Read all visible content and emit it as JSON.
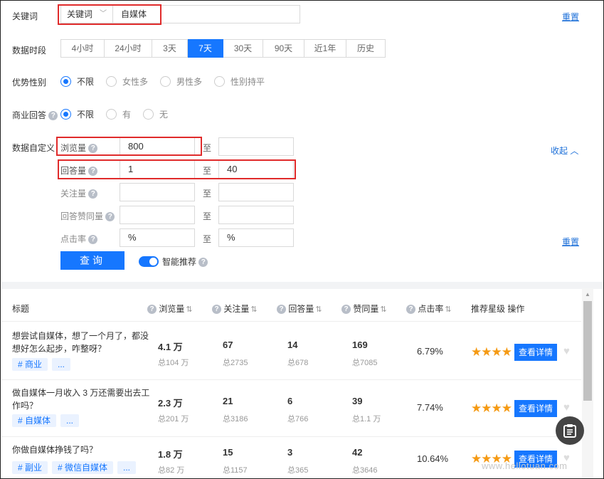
{
  "filters": {
    "keyword_label": "关键词",
    "keyword_type": "关键词",
    "keyword_value": "自媒体",
    "reset_label": "重置",
    "period_label": "数据时段",
    "periods": [
      "4小时",
      "24小时",
      "3天",
      "7天",
      "30天",
      "90天",
      "近1年",
      "历史"
    ],
    "period_active": "7天",
    "gender_label": "优势性别",
    "gender_options": [
      "不限",
      "女性多",
      "男性多",
      "性别持平"
    ],
    "gender_selected": "不限",
    "commercial_label": "商业回答",
    "commercial_options": [
      "不限",
      "有",
      "无"
    ],
    "commercial_selected": "不限",
    "custom_label": "数据自定义",
    "collapse_label": "收起",
    "to_label": "至",
    "ranges": [
      {
        "label": "浏览量",
        "min": "800",
        "max": ""
      },
      {
        "label": "回答量",
        "min": "1",
        "max": "40"
      },
      {
        "label": "关注量",
        "min": "",
        "max": ""
      },
      {
        "label": "回答赞同量",
        "min": "",
        "max": ""
      },
      {
        "label": "点击率",
        "min": "%",
        "max": "%"
      }
    ],
    "reset2_label": "重置",
    "query_label": "查询",
    "smart_label": "智能推荐",
    "smart_on": true
  },
  "table": {
    "headers": {
      "title": "标题",
      "views": "浏览量",
      "follows": "关注量",
      "answers": "回答量",
      "likes": "赞同量",
      "ctr": "点击率",
      "stars": "推荐星级",
      "action": "操作"
    },
    "sort_glyph": "⇅",
    "rows": [
      {
        "title": "想尝试自媒体，想了一个月了，都没想好怎么起步，咋整呀？",
        "tags": [
          "# 商业",
          "..."
        ],
        "views": "4.1 万",
        "views_total": "总104 万",
        "follows": "67",
        "follows_total": "总2735",
        "answers": "14",
        "answers_total": "总678",
        "likes": "169",
        "likes_total": "总7085",
        "ctr": "6.79%",
        "stars": "★★★★",
        "detail": "查看详情"
      },
      {
        "title": "做自媒体一月收入 3 万还需要出去工作吗？",
        "tags": [
          "# 自媒体",
          "..."
        ],
        "views": "2.3 万",
        "views_total": "总201 万",
        "follows": "21",
        "follows_total": "总3186",
        "answers": "6",
        "answers_total": "总766",
        "likes": "39",
        "likes_total": "总1.1 万",
        "ctr": "7.74%",
        "stars": "★★★★",
        "detail": "查看详情"
      },
      {
        "title": "你做自媒体挣钱了吗？",
        "tags": [
          "# 副业",
          "# 微信自媒体",
          "..."
        ],
        "views": "1.8 万",
        "views_total": "总82 万",
        "follows": "15",
        "follows_total": "总1157",
        "answers": "3",
        "answers_total": "总365",
        "likes": "42",
        "likes_total": "总3646",
        "ctr": "10.64%",
        "stars": "★★★★",
        "detail": "查看详情"
      }
    ]
  },
  "watermark": "www.hellotuan.com",
  "colors": {
    "accent": "#1677ff",
    "highlight_box": "#e02b2b",
    "star": "#f59a14"
  }
}
